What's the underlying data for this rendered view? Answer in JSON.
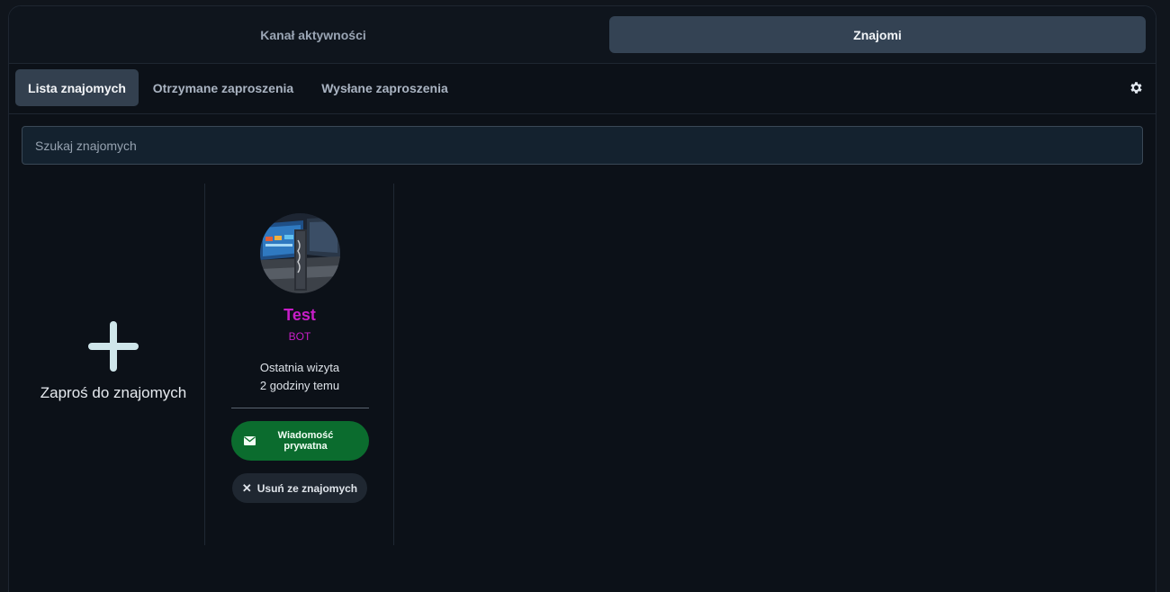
{
  "top_tabs": [
    {
      "label": "Kanał aktywności",
      "active": false
    },
    {
      "label": "Znajomi",
      "active": true
    }
  ],
  "sub_tabs": [
    {
      "label": "Lista znajomych",
      "active": true
    },
    {
      "label": "Otrzymane zaproszenia",
      "active": false
    },
    {
      "label": "Wysłane zaproszenia",
      "active": false
    }
  ],
  "settings_icon": "gear-icon",
  "search": {
    "placeholder": "Szukaj znajomych",
    "value": ""
  },
  "invite": {
    "label": "Zaproś do znajomych",
    "icon": "plus-icon"
  },
  "friends": [
    {
      "name": "Test",
      "badge": "BOT",
      "last_visit_label": "Ostatnia wizyta",
      "last_visit_value": "2 godziny temu",
      "message_button": "Wiadomość prywatna",
      "remove_button": "Usuń ze znajomych",
      "name_color": "#c81ec8"
    }
  ],
  "colors": {
    "background": "#0c1118",
    "active_tab": "#344354",
    "message_button": "#0b6c2e",
    "accent_name": "#c81ec8"
  }
}
